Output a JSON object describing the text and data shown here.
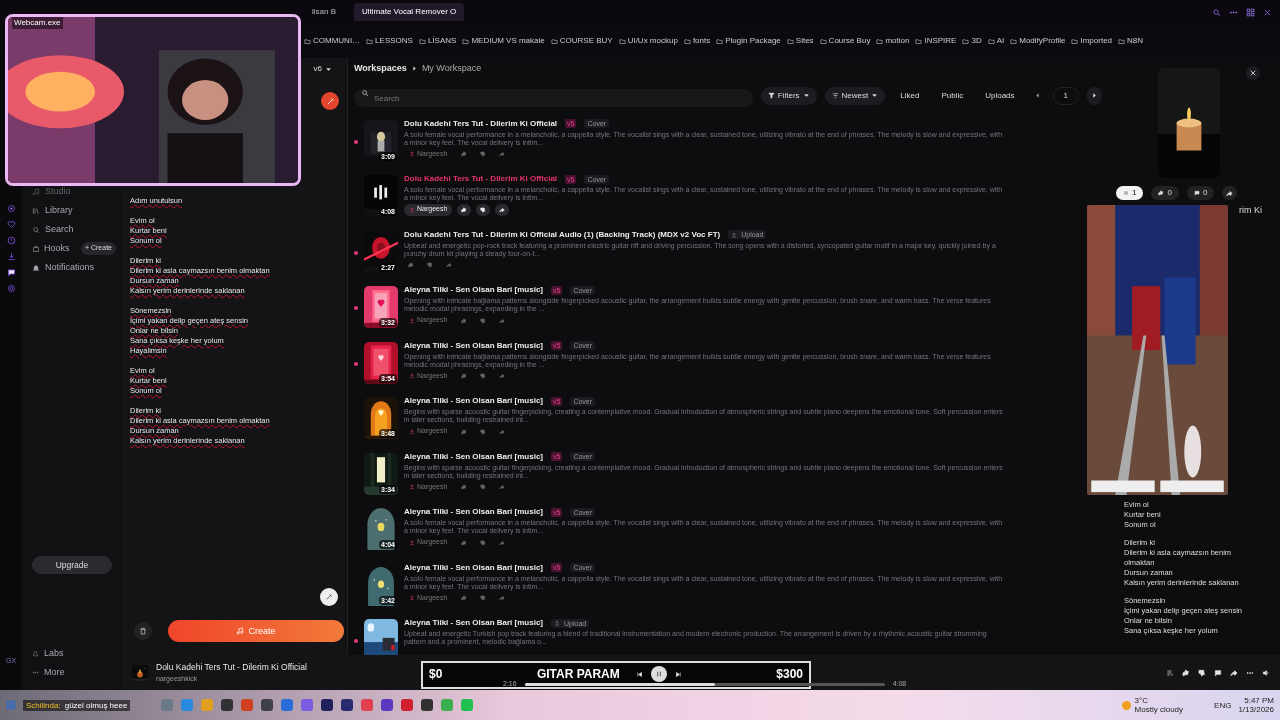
{
  "browser": {
    "tabs": [
      {
        "label": "lisan B",
        "selected": false
      },
      {
        "label": "Ultimate Vocal Remover O",
        "selected": true
      }
    ],
    "bookmarks": [
      "COMMUNI…",
      "LESSONS",
      "LİSANS",
      "MEDIUM VS makale",
      "COURSE BUY",
      "UI/Ux mockup",
      "fonts",
      "Plugin Package",
      "Sites",
      "Course Buy",
      "motion",
      "INSPIRE",
      "3D",
      "AI",
      "ModifyProfile",
      "Imported",
      "N8N"
    ]
  },
  "webcam": {
    "title": "Webcam.exe"
  },
  "sidebar": {
    "version": "v6",
    "items": [
      {
        "label": "Studio"
      },
      {
        "label": "Library"
      },
      {
        "label": "Search"
      },
      {
        "label": "Hooks",
        "action": "+ Create"
      },
      {
        "label": "Notifications"
      }
    ],
    "upgrade": "Upgrade",
    "footer_items": [
      "Labs",
      "More"
    ],
    "rail_badge": "GX"
  },
  "lyrics": {
    "stanzas": [
      [
        "Adım unutulsun"
      ],
      [
        "Evim ol",
        "Kurtar beni",
        "Sonum ol"
      ],
      [
        "Dilerim ki",
        "Dilerim ki asla caymazsın benim olmaktan",
        "Dursun zaman",
        "Kalsın yerim derinlerinde saklanan"
      ],
      [
        "Sönemezsin",
        "İçimi yakan delip geçen ateş sensin",
        "Onlar ne bilsin",
        "Sana çıksa keşke her yolum",
        "Hayalimsin"
      ],
      [
        "Evim ol",
        "Kurtar beni",
        "Sonum ol"
      ],
      [
        "Dilerim ki",
        "Dilerim ki asla caymazsın benim olmaktan",
        "Dursun zaman",
        "Kalsın yerim derinlerinde saklanan"
      ]
    ]
  },
  "create_button": "Create",
  "breadcrumb": [
    "Workspaces",
    "My Workspace"
  ],
  "search": {
    "placeholder": "Search"
  },
  "filters": [
    {
      "label": "Filters",
      "kind": "dropdown"
    },
    {
      "label": "Newest",
      "kind": "dropdown"
    },
    {
      "label": "Liked",
      "kind": "toggle"
    },
    {
      "label": "Public",
      "kind": "toggle"
    },
    {
      "label": "Uploads",
      "kind": "toggle"
    }
  ],
  "page": "1",
  "songs": [
    {
      "title": "Dolu Kadehi Ters Tut - Dilerim Ki Official",
      "version": "v5",
      "tag": "Cover",
      "kind": "cover",
      "description": "A solo female vocal performance in a melancholic, a cappella style. The vocalist sings with a clear, sustained tone, utilizing vibrato at the end of phrases. The melody is slow and expressive, with a minor key feel. The vocal delivery is intim...",
      "duration": "3:09",
      "user": "Nargeesh",
      "new": true,
      "playing": false
    },
    {
      "title": "Dolu Kadehi Ters Tut - Dilerim Ki Official",
      "version": "v5",
      "tag": "Cover",
      "kind": "cover",
      "description": "A solo female vocal performance in a melancholic, a cappella style. The vocalist sings with a clear, sustained tone, utilizing vibrato at the end of phrases. The melody is slow and expressive, with a minor key feel. The vocal delivery is intim...",
      "duration": "4:08",
      "user": "Nargeesh",
      "new": false,
      "playing": true
    },
    {
      "title": "Dolu Kadehi Ters Tut - Dilerim Ki Official Audio (1) (Backing Track) (MDX v2 Voc FT)",
      "tag": "Upload",
      "kind": "upload",
      "description": "Upbeat and energetic pop-rock track featuring a prominent electric guitar riff and driving percussion. The song opens with a distorted, syncopated guitar motif in a major key, quickly joined by a punchy drum kit playing a steady four-on-t...",
      "duration": "2:27",
      "new": true,
      "playing": false
    },
    {
      "title": "Aleyna Tilki - Sen Olsan Bari [music]",
      "version": "v5",
      "tag": "Cover",
      "kind": "cover",
      "description": "Opening with intricate bağlama patterns alongside fingerpicked acoustic guitar, the arrangement builds subtle energy with gentle percussion, brush snare, and warm bass. The verse features melodic modal phrasings, expanding in the ...",
      "duration": "3:32",
      "user": "Nargeesh",
      "new": true,
      "playing": false
    },
    {
      "title": "Aleyna Tilki - Sen Olsan Bari [music]",
      "version": "v5",
      "tag": "Cover",
      "kind": "cover",
      "description": "Opening with intricate bağlama patterns alongside fingerpicked acoustic guitar, the arrangement builds subtle energy with gentle percussion, brush snare, and warm bass. The verse features melodic modal phrasings, expanding in the ...",
      "duration": "3:54",
      "user": "Nargeesh",
      "new": true,
      "playing": false
    },
    {
      "title": "Aleyna Tilki - Sen Olsan Bari [music]",
      "version": "v5",
      "tag": "Cover",
      "kind": "cover",
      "description": "Begins with sparse acoustic guitar fingerpicking, creating a contemplative mood. Gradual introduction of atmospheric strings and subtle piano deepens the emotional tone. Soft percussion enters in later sections, building restrained int...",
      "duration": "3:48",
      "user": "Nargeesh",
      "new": false,
      "playing": false
    },
    {
      "title": "Aleyna Tilki - Sen Olsan Bari [music]",
      "version": "v5",
      "tag": "Cover",
      "kind": "cover",
      "description": "Begins with sparse acoustic guitar fingerpicking, creating a contemplative mood. Gradual introduction of atmospheric strings and subtle piano deepens the emotional tone. Soft percussion enters in later sections, building restrained int...",
      "duration": "3:34",
      "user": "Nargeesh",
      "new": false,
      "playing": false
    },
    {
      "title": "Aleyna Tilki - Sen Olsan Bari [music]",
      "version": "v5",
      "tag": "Cover",
      "kind": "cover",
      "description": "A solo female vocal performance in a melancholic, a cappella style. The vocalist sings with a clear, sustained tone, utilizing vibrato at the end of phrases. The melody is slow and expressive, with a minor key feel. The vocal delivery is intim...",
      "duration": "4:04",
      "user": "Nargeesh",
      "new": false,
      "playing": false
    },
    {
      "title": "Aleyna Tilki - Sen Olsan Bari [music]",
      "version": "v5",
      "tag": "Cover",
      "kind": "cover",
      "description": "A solo female vocal performance in a melancholic, a cappella style. The vocalist sings with a clear, sustained tone, utilizing vibrato at the end of phrases. The melody is slow and expressive, with a minor key feel. The vocal delivery is intim...",
      "duration": "3:42",
      "user": "Nargeesh",
      "new": false,
      "playing": false
    },
    {
      "title": "Aleyna Tilki - Sen Olsan Bari [music]",
      "tag": "Upload",
      "kind": "upload",
      "description": "Upbeat and energetic Turkish pop track featuring a blend of traditional instrumentation and modern electronic production. The arrangement is driven by a rhythmic acoustic guitar strumming pattern and a prominent, melodic bağlama o...",
      "new": true,
      "playing": false
    }
  ],
  "detail": {
    "stats": [
      {
        "kind": "plays",
        "count": "1",
        "selected": true
      },
      {
        "kind": "likes",
        "count": "0",
        "selected": false
      },
      {
        "kind": "comments",
        "count": "0",
        "selected": false
      }
    ],
    "title_fragment": "rim Ki",
    "lyrics": [
      [
        "Evim ol",
        "Kurtar beni",
        "Sonum ol"
      ],
      [
        "Dilerim ki",
        "Dilerim ki asla caymazsın benim olmaktan",
        "Dursun zaman",
        "Kalsın yerim derinlerinde saklanan"
      ],
      [
        "Sönemezsin",
        "İçimi yakan delip geçen ateş sensin",
        "Onlar ne bilsin",
        "Sana çıksa keşke her yolum"
      ]
    ]
  },
  "player": {
    "title": "Dolu Kadehi Ters Tut - Dilerim Ki Official",
    "artist": "nargeeshkick",
    "elapsed": "2:16",
    "total": "4:08",
    "level": 0.53,
    "overlay": {
      "left": "$0",
      "center": "GITAR PARAM",
      "right": "$300"
    }
  },
  "chat": {
    "user": "Schilinda:",
    "message": "güzel olmuş heee"
  },
  "taskbar": {
    "temperature": "3°C",
    "weather": "Mostly cloudy",
    "language": "ENG",
    "time": "5:47 PM",
    "date": "1/13/2026"
  }
}
